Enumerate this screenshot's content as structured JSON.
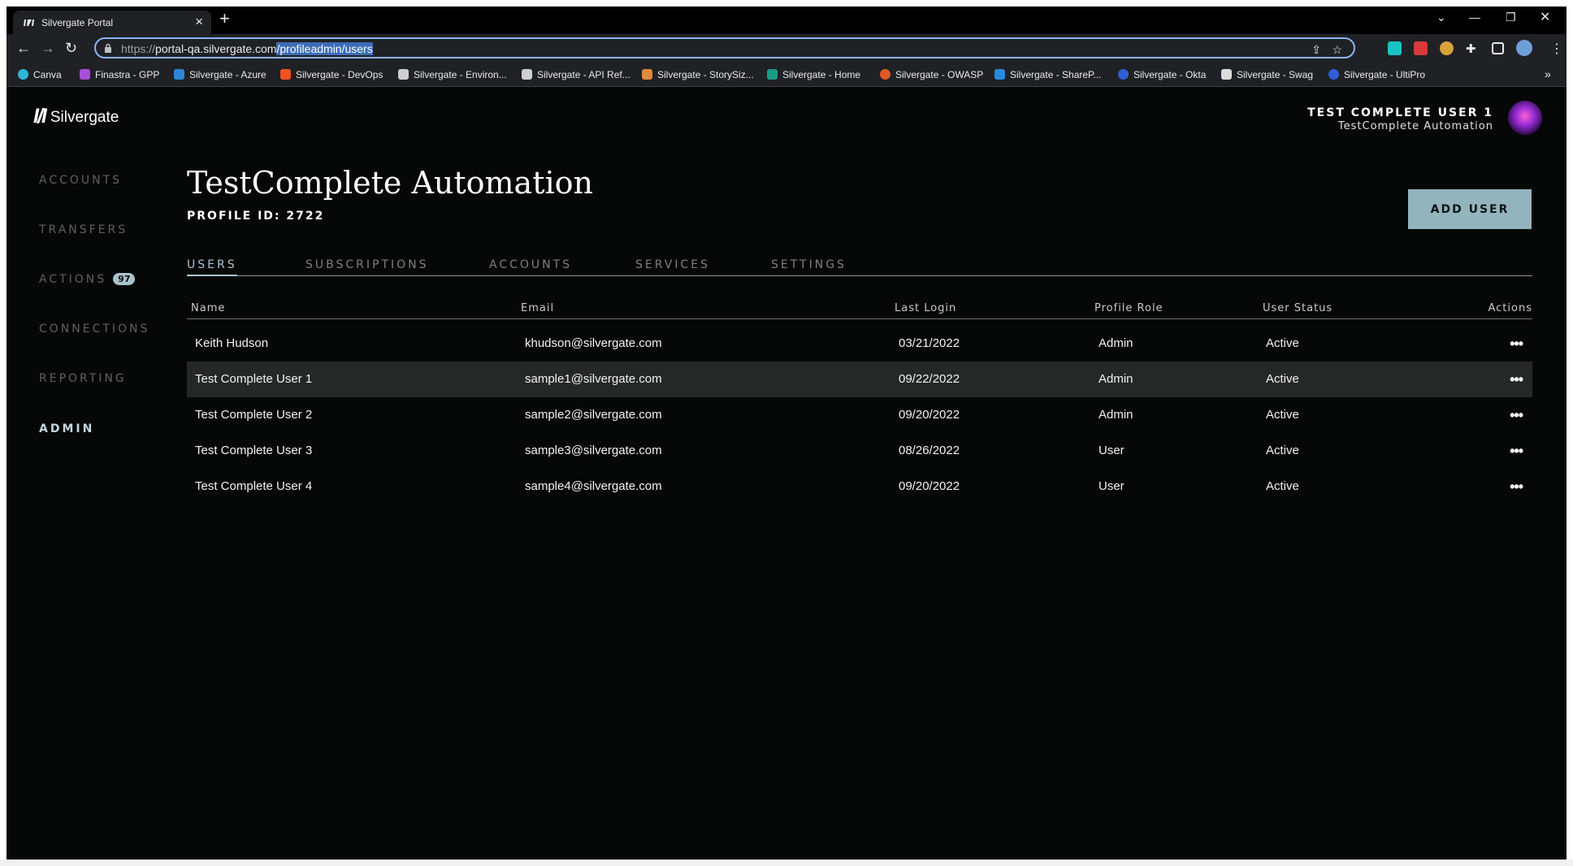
{
  "browser": {
    "tab_title": "Silvergate Portal",
    "new_tab_icon": "+",
    "address": {
      "scheme": "https://",
      "host": "portal-qa.silvergate.com",
      "path": "/profileadmin/users"
    },
    "bookmarks": [
      {
        "label": "Canva",
        "color": "#2fb4d8"
      },
      {
        "label": "Finastra - GPP",
        "color": "#a64fd8"
      },
      {
        "label": "Silvergate - Azure",
        "color": "#2f86d8"
      },
      {
        "label": "Silvergate - DevOps",
        "color": "#f25022"
      },
      {
        "label": "Silvergate - Environ...",
        "color": "#cfcfcf"
      },
      {
        "label": "Silvergate - API Ref...",
        "color": "#cfcfcf"
      },
      {
        "label": "Silvergate - StorySiz...",
        "color": "#e08a3c"
      },
      {
        "label": "Silvergate - Home",
        "color": "#1b9c85"
      },
      {
        "label": "Silvergate - OWASP",
        "color": "#e0592b"
      },
      {
        "label": "Silvergate - ShareP...",
        "color": "#2b8ad8"
      },
      {
        "label": "Silvergate - Okta",
        "color": "#2c5fd8"
      },
      {
        "label": "Silvergate - Swag",
        "color": "#dcdcdc"
      },
      {
        "label": "Silvergate - UltiPro",
        "color": "#2c5fd8"
      }
    ]
  },
  "app": {
    "logo_text": "Silvergate",
    "sidebar": [
      {
        "label": "ACCOUNTS"
      },
      {
        "label": "TRANSFERS"
      },
      {
        "label": "ACTIONS",
        "badge": "97"
      },
      {
        "label": "CONNECTIONS"
      },
      {
        "label": "REPORTING"
      },
      {
        "label": "ADMIN",
        "active": true
      }
    ],
    "user": {
      "name": "TEST COMPLETE USER 1",
      "org": "TestComplete Automation"
    },
    "page": {
      "title": "TestComplete Automation",
      "profile_id": "PROFILE ID: 2722",
      "add_user_label": "ADD USER"
    },
    "tabs": [
      {
        "label": "USERS",
        "active": true
      },
      {
        "label": "SUBSCRIPTIONS"
      },
      {
        "label": "ACCOUNTS"
      },
      {
        "label": "SERVICES"
      },
      {
        "label": "SETTINGS"
      }
    ],
    "table": {
      "columns": [
        "Name",
        "Email",
        "Last Login",
        "Profile Role",
        "User Status",
        "Actions"
      ],
      "rows": [
        {
          "name": "Keith Hudson",
          "email": "khudson@silvergate.com",
          "last_login": "03/21/2022",
          "role": "Admin",
          "status": "Active"
        },
        {
          "name": "Test Complete User 1",
          "email": "sample1@silvergate.com",
          "last_login": "09/22/2022",
          "role": "Admin",
          "status": "Active",
          "highlight": true
        },
        {
          "name": "Test Complete User 2",
          "email": "sample2@silvergate.com",
          "last_login": "09/20/2022",
          "role": "Admin",
          "status": "Active"
        },
        {
          "name": "Test Complete User 3",
          "email": "sample3@silvergate.com",
          "last_login": "08/26/2022",
          "role": "User",
          "status": "Active"
        },
        {
          "name": "Test Complete User 4",
          "email": "sample4@silvergate.com",
          "last_login": "09/20/2022",
          "role": "User",
          "status": "Active"
        }
      ],
      "actions_icon": "•••"
    }
  },
  "colors": {
    "background": "#050806",
    "accent": "#93b4bd",
    "active_nav": "#c3d6df",
    "row_highlight": "#262828"
  }
}
